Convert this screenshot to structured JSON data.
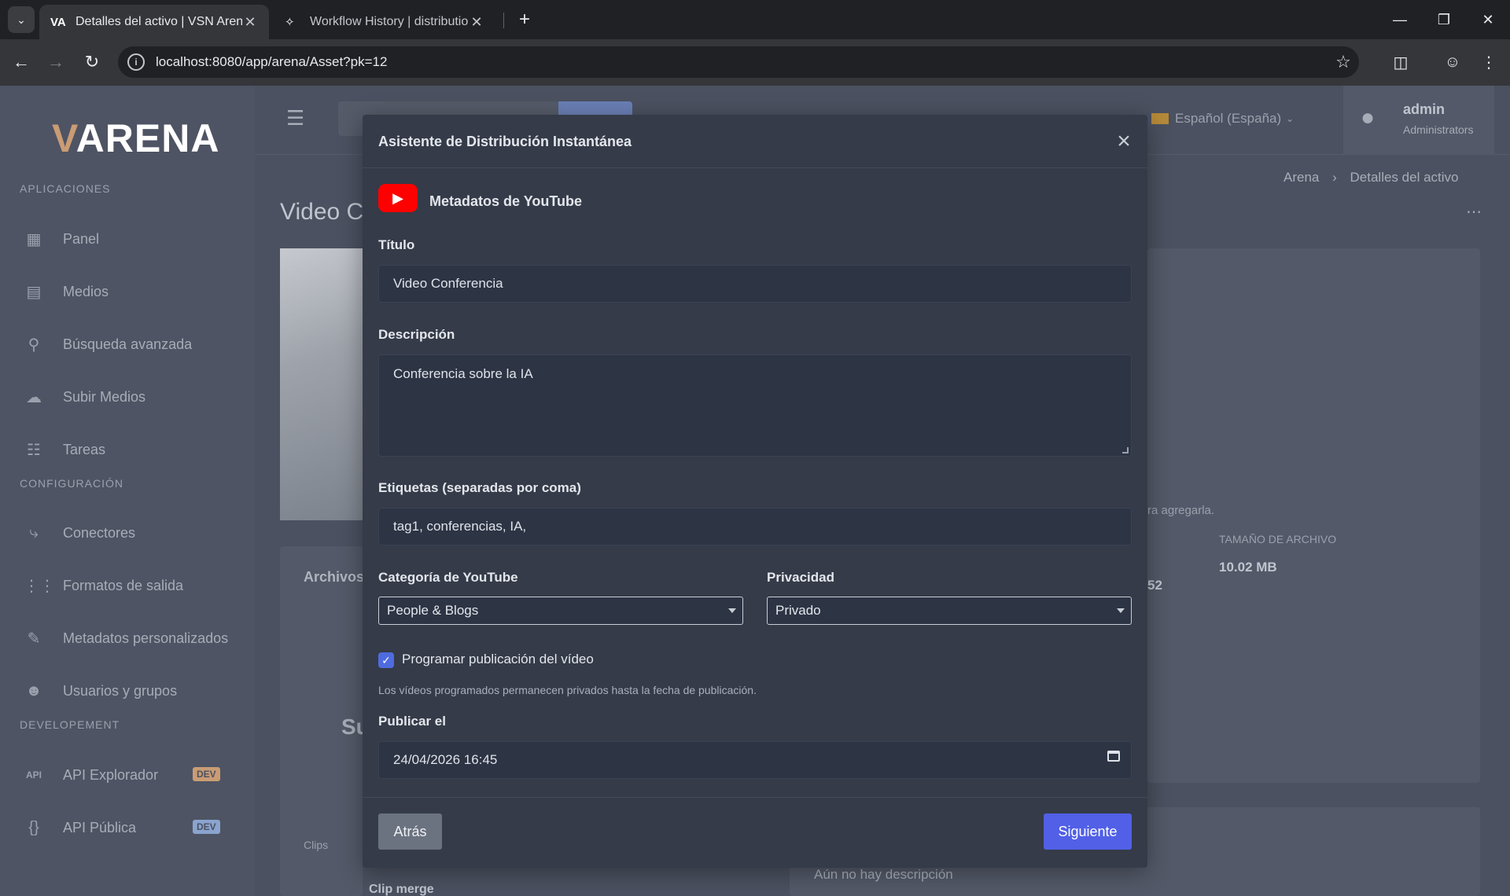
{
  "browser": {
    "tabs": [
      {
        "title": "Detalles del activo | VSN Arena",
        "favicon": "VA",
        "active": true
      },
      {
        "title": "Workflow History | distribution-",
        "favicon": "workflow-icon",
        "active": false
      }
    ],
    "url": "localhost:8080/app/arena/Asset?pk=12"
  },
  "app": {
    "logo": {
      "v": "V",
      "rest": "ARENA"
    },
    "sidebar": {
      "sections": [
        {
          "label": "APLICACIONES",
          "items": [
            {
              "label": "Panel",
              "icon": "dashboard-icon"
            },
            {
              "label": "Medios",
              "icon": "film-icon"
            },
            {
              "label": "Búsqueda avanzada",
              "icon": "search-icon"
            },
            {
              "label": "Subir Medios",
              "icon": "cloud-upload-icon"
            },
            {
              "label": "Tareas",
              "icon": "clipboard-icon"
            }
          ]
        },
        {
          "label": "CONFIGURACIÓN",
          "items": [
            {
              "label": "Conectores",
              "icon": "plug-icon"
            },
            {
              "label": "Formatos de salida",
              "icon": "sliders-icon"
            },
            {
              "label": "Metadatos personalizados",
              "icon": "edit-file-icon"
            },
            {
              "label": "Usuarios y grupos",
              "icon": "users-icon"
            }
          ]
        },
        {
          "label": "DEVELOPEMENT",
          "items": [
            {
              "label": "API Explorador",
              "icon": "api-icon",
              "badge": "DEV"
            },
            {
              "label": "API Pública",
              "icon": "braces-icon",
              "badge": "DEV"
            }
          ]
        }
      ]
    },
    "header": {
      "language": "Español (España)",
      "user": {
        "name": "admin",
        "role": "Administrators"
      }
    },
    "breadcrumb": {
      "root": "Arena",
      "current": "Detalles del activo"
    },
    "page_title": "Video C",
    "background": {
      "archivos": "Archivos",
      "su": "Su",
      "clips": "Clips",
      "clip_merge": "Clip merge",
      "agregarla": "ra agregarla.",
      "tamano_label": "TAMAÑO DE ARCHIVO",
      "tamano_value": "10.02 MB",
      "partial_value": "52",
      "no_desc": "Aún no hay descripción"
    }
  },
  "modal": {
    "title": "Asistente de Distribución Instantánea",
    "section": "Metadatos de YouTube",
    "fields": {
      "titulo_label": "Título",
      "titulo_value": "Video Conferencia",
      "descripcion_label": "Descripción",
      "descripcion_value": "Conferencia sobre la IA",
      "etiquetas_label": "Etiquetas (separadas por coma)",
      "etiquetas_value": "tag1, conferencias, IA,",
      "categoria_label": "Categoría de YouTube",
      "categoria_value": "People & Blogs",
      "privacidad_label": "Privacidad",
      "privacidad_value": "Privado",
      "programar_label": "Programar publicación del vídeo",
      "programar_checked": true,
      "programar_help": "Los vídeos programados permanecen privados hasta la fecha de publicación.",
      "publicar_label": "Publicar el",
      "publicar_value": "24/04/2026 16:45"
    },
    "buttons": {
      "back": "Atrás",
      "next": "Siguiente"
    }
  },
  "colors": {
    "accent": "#5160e6",
    "youtube": "#ff0000",
    "modal_bg": "#353b48"
  }
}
